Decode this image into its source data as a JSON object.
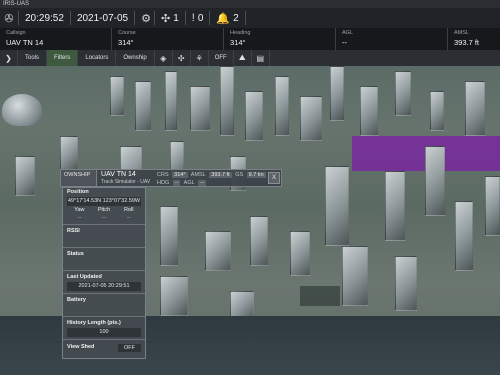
{
  "window": {
    "title": "IRIS-UAS"
  },
  "status": {
    "logo_icon": "drone-icon",
    "time": "20:29:52",
    "date": "2021-07-05",
    "settings_icon": "gear-icon",
    "aircraft_count": "1",
    "alert_count": "0",
    "notification_count": "2"
  },
  "info": {
    "callsign_label": "Callsign",
    "callsign": "UAV TN 14",
    "course_label": "Course",
    "course": "314°",
    "heading_label": "Heading",
    "heading": "314°",
    "agl_label": "AGL",
    "agl": "--",
    "amsl_label": "AMSL",
    "amsl": "393.7 ft"
  },
  "toolbar": {
    "menu_icon": "chevron-right-icon",
    "tools": "Tools",
    "filters": "Filters",
    "locators": "Locators",
    "ownship": "Ownship",
    "off": "OFF"
  },
  "popup": {
    "tab": "OWNSHIP",
    "title": "UAV TN 14",
    "subtitle": "Track Simulator - UAV",
    "crs_label": "CRS",
    "crs": "314°",
    "amsl_label": "AMSL",
    "amsl": "393.7 ft",
    "gs_label": "GS",
    "gs": "9.7 kn",
    "hdg_label": "HDG",
    "hdg": "--",
    "agl_label": "AGL",
    "agl": "--",
    "close": "X"
  },
  "panel": {
    "position_label": "Position",
    "position": "49°17'14.53N 123°07'32.59W",
    "yaw_label": "Yaw",
    "pitch_label": "Pitch",
    "roll_label": "Roll",
    "yaw": "--",
    "pitch": "--",
    "roll": "--",
    "rssi_label": "RSSI",
    "status_label": "Status",
    "last_updated_label": "Last Updated",
    "last_updated": "2021-07-05 20:29:51",
    "battery_label": "Battery",
    "history_label": "History Length (pts.)",
    "history": "100",
    "viewshed_label": "View Shed",
    "viewshed": "OFF"
  },
  "colors": {
    "accent_orange": "#e0a53a",
    "active_filter": "#3d5a3f",
    "overlay_purple": "#7828a0"
  }
}
